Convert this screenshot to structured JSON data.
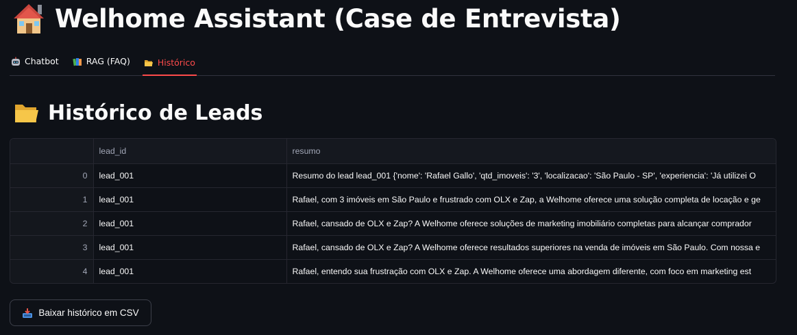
{
  "app": {
    "title": "Welhome Assistant (Case de Entrevista)",
    "title_icon": "house-emoji"
  },
  "tabs": [
    {
      "label": "Chatbot",
      "icon": "robot-icon",
      "active": false
    },
    {
      "label": "RAG (FAQ)",
      "icon": "books-icon",
      "active": false
    },
    {
      "label": "Histórico",
      "icon": "folder-icon",
      "active": true
    }
  ],
  "section": {
    "title": "Histórico de Leads",
    "icon": "folder-icon"
  },
  "table": {
    "columns": [
      "",
      "lead_id",
      "resumo"
    ],
    "rows": [
      {
        "index": "0",
        "lead_id": "lead_001",
        "resumo": "Resumo do lead lead_001 {'nome': 'Rafael Gallo', 'qtd_imoveis': '3', 'localizacao': 'São Paulo - SP', 'experiencia': 'Já utilizei O"
      },
      {
        "index": "1",
        "lead_id": "lead_001",
        "resumo": "Rafael, com 3 imóveis em São Paulo e frustrado com OLX e Zap, a Welhome oferece uma solução completa de locação e ge"
      },
      {
        "index": "2",
        "lead_id": "lead_001",
        "resumo": "Rafael, cansado de OLX e Zap?  A Welhome oferece soluções de marketing imobiliário completas para alcançar comprador"
      },
      {
        "index": "3",
        "lead_id": "lead_001",
        "resumo": "Rafael, cansado de OLX e Zap?  A Welhome oferece resultados superiores na venda de imóveis em São Paulo.  Com nossa e"
      },
      {
        "index": "4",
        "lead_id": "lead_001",
        "resumo": "Rafael, entendo sua frustração com OLX e Zap.  A Welhome oferece uma abordagem diferente, com foco em marketing est"
      }
    ]
  },
  "download": {
    "label": "Baixar histórico em CSV",
    "icon": "inbox-tray-icon"
  },
  "colors": {
    "background": "#0e1117",
    "accent": "#ff4b4b",
    "text": "#fafafa"
  }
}
